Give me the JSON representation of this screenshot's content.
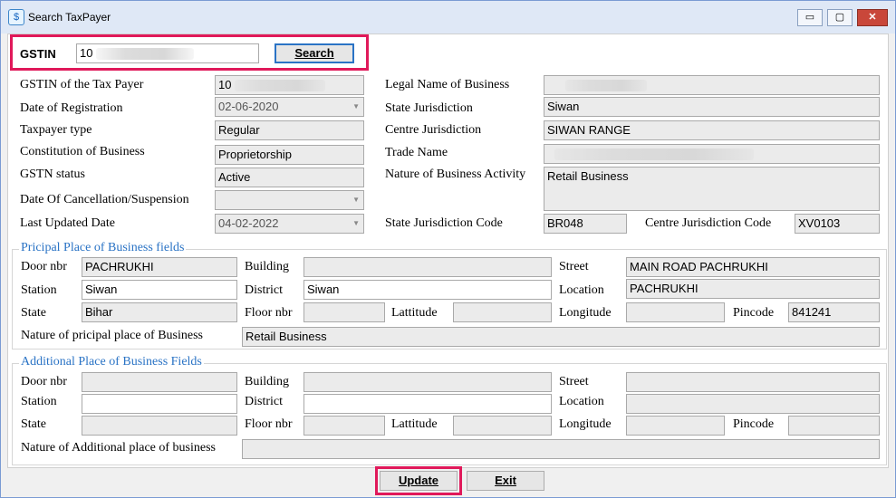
{
  "window": {
    "title": "Search TaxPayer",
    "buttons": {
      "minimize": "▭",
      "maximize": "▢",
      "close": "✕"
    }
  },
  "search": {
    "label": "GSTIN",
    "value": "10",
    "button": "Search"
  },
  "taxpayer": {
    "gstin_label": "GSTIN of the Tax Payer",
    "gstin_value": "10",
    "reg_date_label": "Date of Registration",
    "reg_date_value": "02-06-2020",
    "type_label": "Taxpayer type",
    "type_value": "Regular",
    "constitution_label": "Constitution of Business",
    "constitution_value": "Proprietorship",
    "status_label": "GSTN status",
    "status_value": "Active",
    "cancel_label": "Date Of Cancellation/Suspension",
    "cancel_value": "",
    "updated_label": "Last Updated Date",
    "updated_value": "04-02-2022",
    "legal_name_label": "Legal Name of Business",
    "legal_name_value": "",
    "state_juris_label": "State Jurisdiction",
    "state_juris_value": "Siwan",
    "centre_juris_label": "Centre Jurisdiction",
    "centre_juris_value": "SIWAN RANGE",
    "trade_name_label": "Trade Name",
    "trade_name_value": "",
    "nature_label": "Nature of Business Activity",
    "nature_value": "Retail Business",
    "state_code_label": "State Jurisdiction Code",
    "state_code_value": "BR048",
    "centre_code_label": "Centre Jurisdiction Code",
    "centre_code_value": "XV0103"
  },
  "principal": {
    "title": "Pricipal Place of Business fields",
    "door_label": "Door nbr",
    "door_value": "PACHRUKHI",
    "building_label": "Building",
    "building_value": "",
    "street_label": "Street",
    "street_value": "MAIN ROAD PACHRUKHI",
    "station_label": "Station",
    "station_value": "Siwan",
    "district_label": "District",
    "district_value": "Siwan",
    "location_label": "Location",
    "location_value": "PACHRUKHI",
    "state_label": "State",
    "state_value": "Bihar",
    "floor_label": "Floor nbr",
    "floor_value": "",
    "lat_label": "Lattitude",
    "lat_value": "",
    "long_label": "Longitude",
    "long_value": "",
    "pin_label": "Pincode",
    "pin_value": "841241",
    "nature_label": "Nature of pricipal place of Business",
    "nature_value": "Retail Business"
  },
  "additional": {
    "title": "Additional Place of Business Fields",
    "door_label": "Door nbr",
    "door_value": "",
    "building_label": "Building",
    "building_value": "",
    "street_label": "Street",
    "street_value": "",
    "station_label": "Station",
    "station_value": "",
    "district_label": "District",
    "district_value": "",
    "location_label": "Location",
    "location_value": "",
    "state_label": "State",
    "state_value": "",
    "floor_label": "Floor nbr",
    "floor_value": "",
    "lat_label": "Lattitude",
    "lat_value": "",
    "long_label": "Longitude",
    "long_value": "",
    "pin_label": "Pincode",
    "pin_value": "",
    "nature_label": "Nature of Additional place of business",
    "nature_value": ""
  },
  "footer": {
    "update": "Update",
    "exit": "Exit"
  },
  "colors": {
    "highlight": "#e0195a",
    "group_title": "#2a73c5"
  }
}
